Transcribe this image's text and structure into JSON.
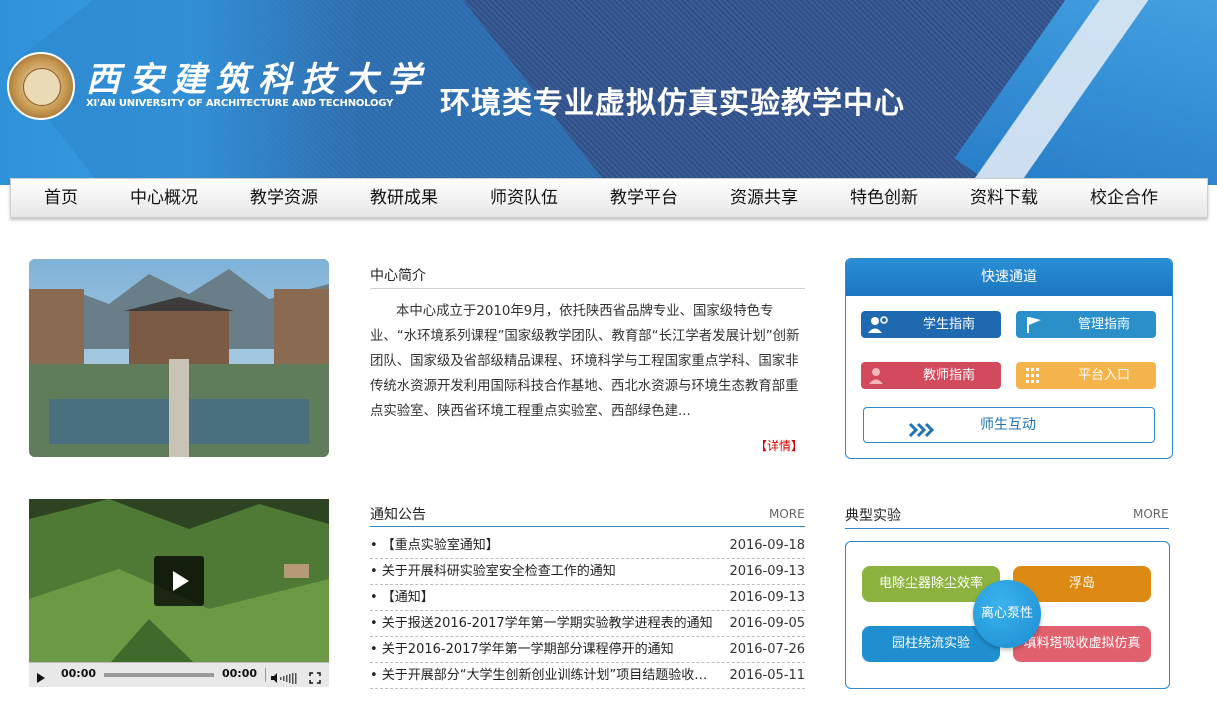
{
  "header": {
    "school_name_cn": "西安建筑科技大学",
    "school_name_en": "XI'AN UNIVERSITY OF ARCHITECTURE AND TECHNOLOGY",
    "site_title": "环境类专业虚拟仿真实验教学中心"
  },
  "nav": {
    "items": [
      "首页",
      "中心概况",
      "教学资源",
      "教研成果",
      "师资队伍",
      "教学平台",
      "资源共享",
      "特色创新",
      "资料下载",
      "校企合作"
    ]
  },
  "intro": {
    "title": "中心简介",
    "text": "本中心成立于2010年9月，依托陕西省品牌专业、国家级特色专业、“水环境系列课程”国家级教学团队、教育部“长江学者发展计划”创新团队、国家级及省部级精品课程、环境科学与工程国家重点学科、国家非传统水资源开发利用国际科技合作基地、西北水资源与环境生态教育部重点实验室、陕西省环境工程重点实验室、西部绿色建...",
    "detail_link": "【详情】"
  },
  "quick": {
    "title": "快速通道",
    "buttons": [
      {
        "label": "学生指南",
        "color": "#1f69b1",
        "icon": "users-icon"
      },
      {
        "label": "管理指南",
        "color": "#2b8fc9",
        "icon": "flag-icon"
      },
      {
        "label": "教师指南",
        "color": "#d24a5c",
        "icon": "teacher-icon"
      },
      {
        "label": "平台入口",
        "color": "#f5b34b",
        "icon": "grid-icon"
      }
    ],
    "wide_button": {
      "label": "师生互动",
      "icon": "chevrons-right-icon"
    }
  },
  "video": {
    "current_time": "00:00",
    "duration": "00:00"
  },
  "notices": {
    "title": "通知公告",
    "more": "MORE",
    "items": [
      {
        "title": "• 【重点实验室通知】",
        "date": "2016-09-18"
      },
      {
        "title": "• 关于开展科研实验室安全检查工作的通知",
        "date": "2016-09-13"
      },
      {
        "title": "• 【通知】",
        "date": "2016-09-13"
      },
      {
        "title": "• 关于报送2016-2017学年第一学期实验教学进程表的通知",
        "date": "2016-09-05"
      },
      {
        "title": "• 关于2016-2017学年第一学期部分课程停开的通知",
        "date": "2016-07-26"
      },
      {
        "title": "• 关于开展部分“大学生创新创业训练计划”项目结题验收的通知",
        "date": "2016-05-11"
      }
    ]
  },
  "experiments": {
    "title": "典型实验",
    "more": "MORE",
    "items": [
      {
        "label": "电除尘器除尘效率",
        "color": "#8cb33f"
      },
      {
        "label": "浮岛",
        "color": "#dc8a14"
      },
      {
        "label": "园柱绕流实验",
        "color": "#1f8fd0"
      },
      {
        "label": "填料塔吸收虚拟仿真",
        "color": "#e0606e"
      }
    ],
    "center_item": {
      "label": "离心泵性",
      "color": "#1a8ccf"
    }
  }
}
